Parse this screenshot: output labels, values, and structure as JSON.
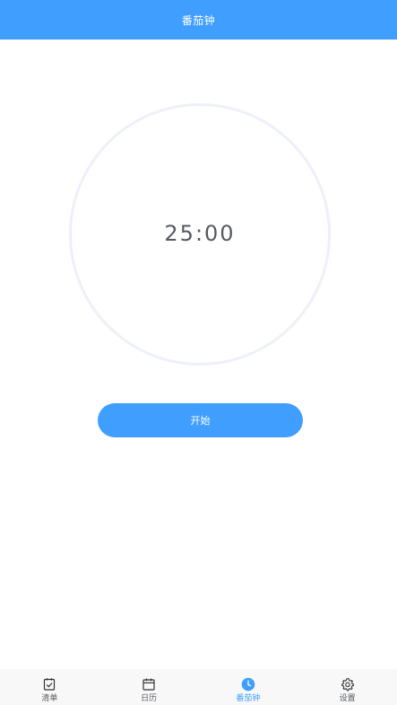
{
  "header": {
    "title": "番茄钟"
  },
  "timer": {
    "display": "25:00"
  },
  "controls": {
    "start_label": "开始"
  },
  "tabbar": {
    "items": [
      {
        "label": "清单",
        "icon": "checklist-icon"
      },
      {
        "label": "日历",
        "icon": "calendar-icon"
      },
      {
        "label": "番茄钟",
        "icon": "clock-icon",
        "active": true
      },
      {
        "label": "设置",
        "icon": "gear-icon"
      }
    ]
  },
  "colors": {
    "accent": "#409eff",
    "text": "#555a60",
    "ring": "#eef0f9",
    "tabbar_bg": "#f8f8f8"
  }
}
